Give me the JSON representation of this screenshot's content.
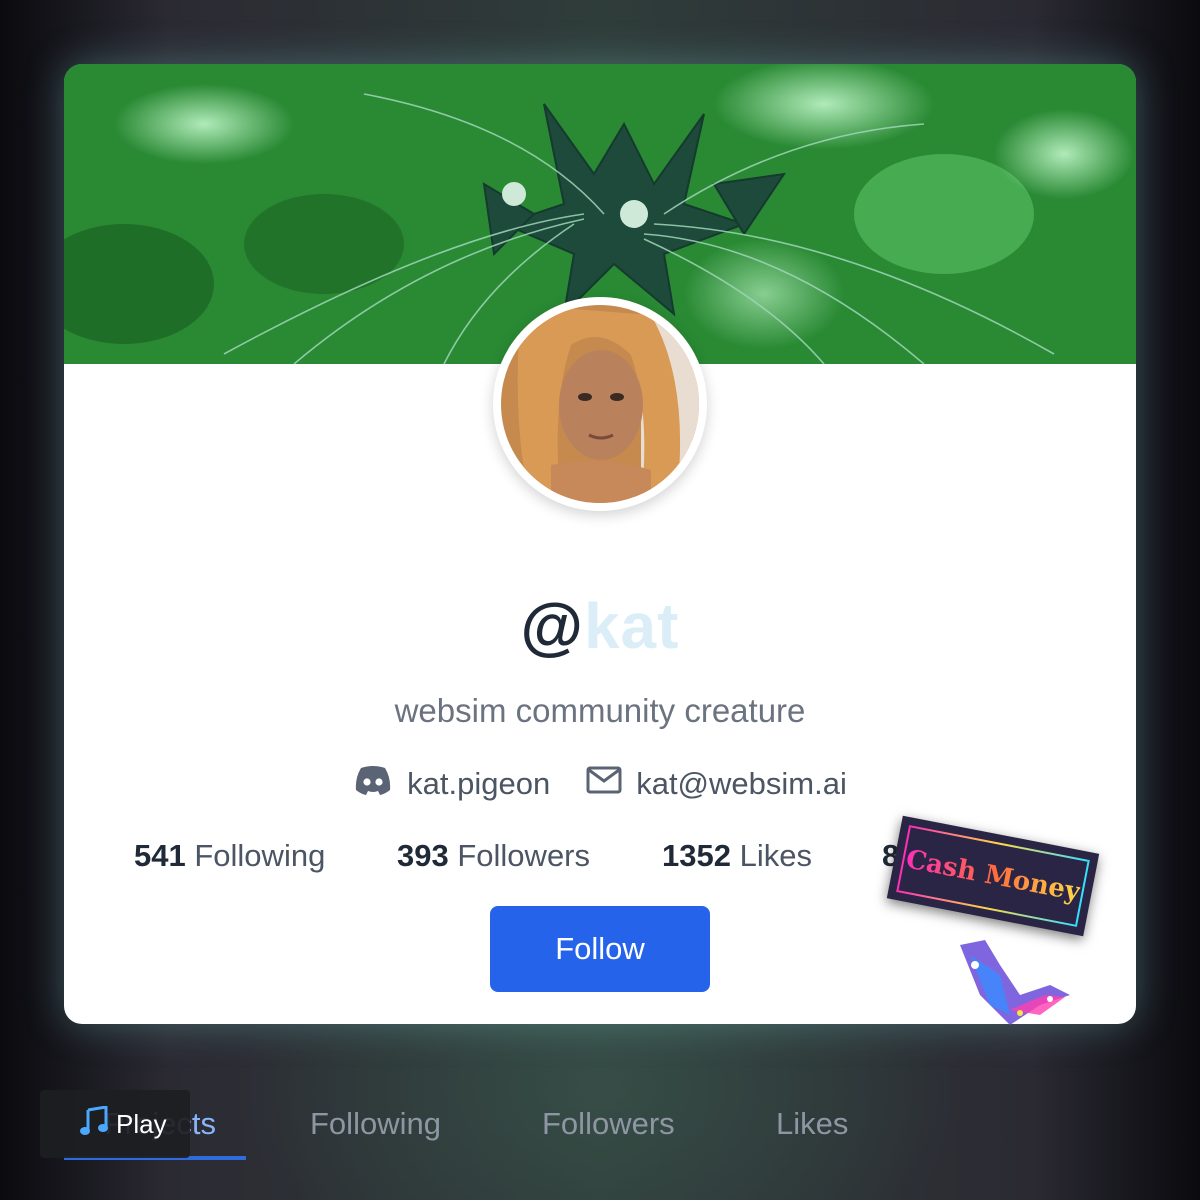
{
  "profile": {
    "username_prefix": "@",
    "username_visible": "kat",
    "bio": "websim community creature",
    "discord": "kat.pigeon",
    "email": "kat@websim.ai"
  },
  "stats": [
    {
      "count": "541",
      "label": "Following"
    },
    {
      "count": "393",
      "label": "Followers"
    },
    {
      "count": "1352",
      "label": "Likes"
    },
    {
      "count": "8",
      "label": ""
    }
  ],
  "follow_button": "Follow",
  "sticker": {
    "text": "Cash Money"
  },
  "tabs": [
    "Projects",
    "Following",
    "Followers",
    "Likes"
  ],
  "active_tab": "Projects",
  "player": {
    "icon": "music-note-icon",
    "label": "Play"
  },
  "colors": {
    "accent": "#2563eb",
    "tab_underline": "#2f6bdc",
    "username": "#1f2937",
    "secondary_text": "#6b7280"
  },
  "icons": [
    "discord-icon",
    "mail-icon",
    "music-note-icon"
  ]
}
